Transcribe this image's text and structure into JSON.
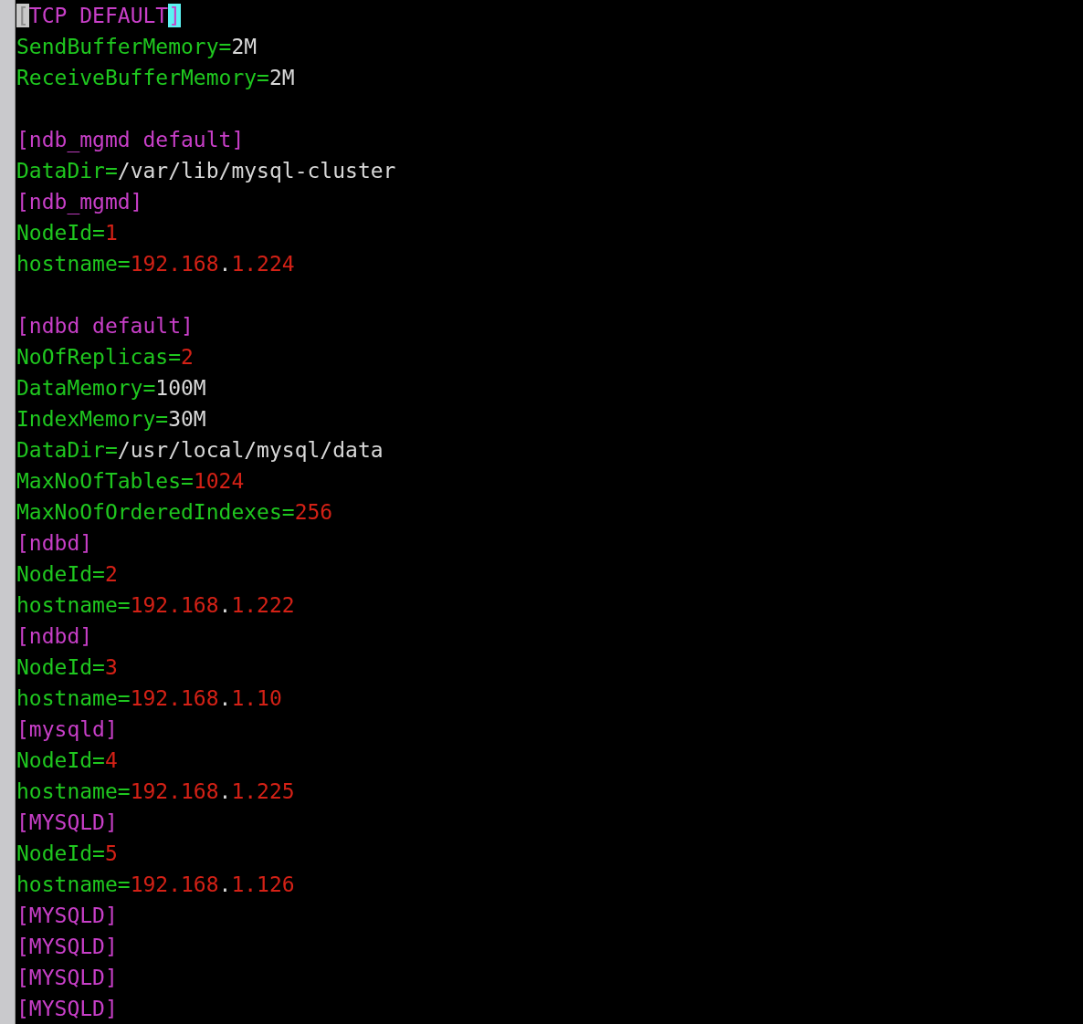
{
  "editor": {
    "blocks": [
      {
        "lines": [
          {
            "segments": [
              {
                "kind": "cursor",
                "text": "["
              },
              {
                "kind": "section",
                "text": "TCP DEFAULT"
              },
              {
                "kind": "match",
                "text": "]"
              }
            ]
          },
          {
            "segments": [
              {
                "kind": "key",
                "text": "SendBufferMemory="
              },
              {
                "kind": "text",
                "text": "2M"
              }
            ]
          },
          {
            "segments": [
              {
                "kind": "key",
                "text": "ReceiveBufferMemory="
              },
              {
                "kind": "text",
                "text": "2M"
              }
            ]
          }
        ]
      },
      {
        "lines": [
          {
            "segments": [
              {
                "kind": "section",
                "text": "[ndb_mgmd default]"
              }
            ]
          },
          {
            "segments": [
              {
                "kind": "key",
                "text": "DataDir="
              },
              {
                "kind": "text",
                "text": "/var/lib/mysql-cluster"
              }
            ]
          },
          {
            "segments": [
              {
                "kind": "section",
                "text": "[ndb_mgmd]"
              }
            ]
          },
          {
            "segments": [
              {
                "kind": "key",
                "text": "NodeId="
              },
              {
                "kind": "num",
                "text": "1"
              }
            ]
          },
          {
            "segments": [
              {
                "kind": "key",
                "text": "hostname="
              },
              {
                "kind": "num",
                "text": "192.168"
              },
              {
                "kind": "text",
                "text": "."
              },
              {
                "kind": "num",
                "text": "1.224"
              }
            ]
          }
        ]
      },
      {
        "lines": [
          {
            "segments": [
              {
                "kind": "section",
                "text": "[ndbd default]"
              }
            ]
          },
          {
            "segments": [
              {
                "kind": "key",
                "text": "NoOfReplicas="
              },
              {
                "kind": "num",
                "text": "2"
              }
            ]
          },
          {
            "segments": [
              {
                "kind": "key",
                "text": "DataMemory="
              },
              {
                "kind": "text",
                "text": "100M"
              }
            ]
          },
          {
            "segments": [
              {
                "kind": "key",
                "text": "IndexMemory="
              },
              {
                "kind": "text",
                "text": "30M"
              }
            ]
          },
          {
            "segments": [
              {
                "kind": "key",
                "text": "DataDir="
              },
              {
                "kind": "text",
                "text": "/usr/local/mysql/data"
              }
            ]
          },
          {
            "segments": [
              {
                "kind": "key",
                "text": "MaxNoOfTables="
              },
              {
                "kind": "num",
                "text": "1024"
              }
            ]
          },
          {
            "segments": [
              {
                "kind": "key",
                "text": "MaxNoOfOrderedIndexes="
              },
              {
                "kind": "num",
                "text": "256"
              }
            ]
          },
          {
            "segments": [
              {
                "kind": "section",
                "text": "[ndbd]"
              }
            ]
          },
          {
            "segments": [
              {
                "kind": "key",
                "text": "NodeId="
              },
              {
                "kind": "num",
                "text": "2"
              }
            ]
          },
          {
            "segments": [
              {
                "kind": "key",
                "text": "hostname="
              },
              {
                "kind": "num",
                "text": "192.168"
              },
              {
                "kind": "text",
                "text": "."
              },
              {
                "kind": "num",
                "text": "1.222"
              }
            ]
          },
          {
            "segments": [
              {
                "kind": "section",
                "text": "[ndbd]"
              }
            ]
          },
          {
            "segments": [
              {
                "kind": "key",
                "text": "NodeId="
              },
              {
                "kind": "num",
                "text": "3"
              }
            ]
          },
          {
            "segments": [
              {
                "kind": "key",
                "text": "hostname="
              },
              {
                "kind": "num",
                "text": "192.168"
              },
              {
                "kind": "text",
                "text": "."
              },
              {
                "kind": "num",
                "text": "1.10"
              }
            ]
          },
          {
            "segments": [
              {
                "kind": "section",
                "text": "[mysqld]"
              }
            ]
          },
          {
            "segments": [
              {
                "kind": "key",
                "text": "NodeId="
              },
              {
                "kind": "num",
                "text": "4"
              }
            ]
          },
          {
            "segments": [
              {
                "kind": "key",
                "text": "hostname="
              },
              {
                "kind": "num",
                "text": "192.168"
              },
              {
                "kind": "text",
                "text": "."
              },
              {
                "kind": "num",
                "text": "1.225"
              }
            ]
          },
          {
            "segments": [
              {
                "kind": "section",
                "text": "[MYSQLD]"
              }
            ]
          },
          {
            "segments": [
              {
                "kind": "key",
                "text": "NodeId="
              },
              {
                "kind": "num",
                "text": "5"
              }
            ]
          },
          {
            "segments": [
              {
                "kind": "key",
                "text": "hostname="
              },
              {
                "kind": "num",
                "text": "192.168"
              },
              {
                "kind": "text",
                "text": "."
              },
              {
                "kind": "num",
                "text": "1.126"
              }
            ]
          },
          {
            "segments": [
              {
                "kind": "section",
                "text": "[MYSQLD]"
              }
            ]
          },
          {
            "segments": [
              {
                "kind": "section",
                "text": "[MYSQLD]"
              }
            ]
          },
          {
            "segments": [
              {
                "kind": "section",
                "text": "[MYSQLD]"
              }
            ]
          },
          {
            "segments": [
              {
                "kind": "section",
                "text": "[MYSQLD]"
              }
            ]
          }
        ]
      }
    ]
  }
}
